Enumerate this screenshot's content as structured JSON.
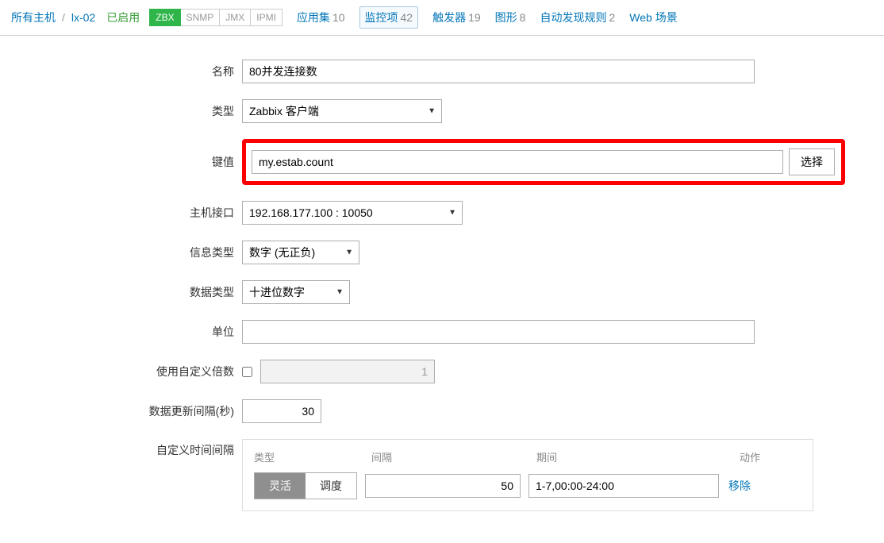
{
  "breadcrumb": {
    "all_hosts": "所有主机",
    "host": "lx-02"
  },
  "status": {
    "enabled": "已启用"
  },
  "tags": {
    "zbx": "ZBX",
    "snmp": "SNMP",
    "jmx": "JMX",
    "ipmi": "IPMI"
  },
  "nav": {
    "apps": {
      "label": "应用集",
      "count": "10"
    },
    "items": {
      "label": "监控项",
      "count": "42"
    },
    "triggers": {
      "label": "触发器",
      "count": "19"
    },
    "graphs": {
      "label": "图形",
      "count": "8"
    },
    "discovery": {
      "label": "自动发现规则",
      "count": "2"
    },
    "web": {
      "label": "Web 场景",
      "count": ""
    }
  },
  "form": {
    "name": {
      "label": "名称",
      "value": "80并发连接数"
    },
    "type": {
      "label": "类型",
      "value": "Zabbix 客户端"
    },
    "key": {
      "label": "键值",
      "value": "my.estab.count",
      "select_btn": "选择"
    },
    "iface": {
      "label": "主机接口",
      "value": "192.168.177.100 : 10050"
    },
    "info": {
      "label": "信息类型",
      "value": "数字 (无正负)"
    },
    "data": {
      "label": "数据类型",
      "value": "十进位数字"
    },
    "unit": {
      "label": "单位",
      "value": ""
    },
    "mult": {
      "label": "使用自定义倍数",
      "value": "1"
    },
    "upd": {
      "label": "数据更新间隔(秒)",
      "value": "30"
    },
    "custint": {
      "label": "自定义时间间隔"
    }
  },
  "interval": {
    "head": {
      "type": "类型",
      "interval": "间隔",
      "period": "期间",
      "action": "动作"
    },
    "seg": {
      "flex": "灵活",
      "sched": "调度"
    },
    "interval_value": "50",
    "period_value": "1-7,00:00-24:00",
    "remove": "移除"
  }
}
